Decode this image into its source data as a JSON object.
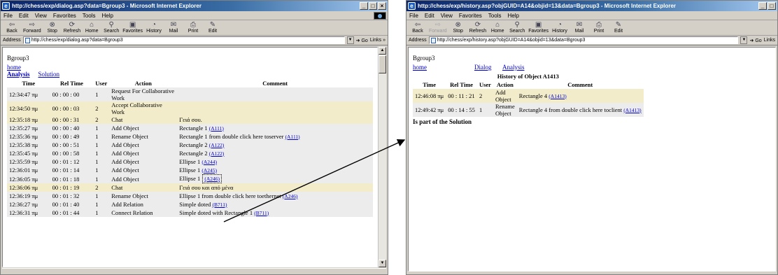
{
  "left_window": {
    "title": "http://chess/exp/dialog.asp?data=Bgroup3 - Microsoft Internet Explorer",
    "menu": [
      "File",
      "Edit",
      "View",
      "Favorites",
      "Tools",
      "Help"
    ],
    "toolbar": [
      "Back",
      "Forward",
      "Stop",
      "Refresh",
      "Home",
      "Search",
      "Favorites",
      "History",
      "Mail",
      "Print",
      "Edit"
    ],
    "address_label": "Address",
    "address": "http://chess/exp/dialog.asp?data=Bgroup3",
    "go": "Go",
    "links": "Links »",
    "page": {
      "heading": "Bgroup3",
      "home_link": "home",
      "analysis_link": "Analysis",
      "solution_link": "Solution",
      "columns": [
        "Time",
        "Rel Time",
        "User",
        "Action",
        "Comment"
      ],
      "rows": [
        {
          "time": "12:34:47 πμ",
          "rel": "00 : 00 : 00",
          "user": "1",
          "action": "Request For Collaborative Work",
          "comment": "",
          "ref": "",
          "style": "gr"
        },
        {
          "time": "12:34:50 πμ",
          "rel": "00 : 00 : 03",
          "user": "2",
          "action": "Accept Collaborative Work",
          "comment": "",
          "ref": "",
          "style": "hl"
        },
        {
          "time": "12:35:18 πμ",
          "rel": "00 : 00 : 31",
          "user": "2",
          "action": "Chat",
          "comment": "Γειά σου.",
          "ref": "",
          "style": "hl"
        },
        {
          "time": "12:35:27 πμ",
          "rel": "00 : 00 : 40",
          "user": "1",
          "action": "Add Object",
          "comment": "Rectangle 1",
          "ref": "(A111)",
          "style": "gr"
        },
        {
          "time": "12:35:36 πμ",
          "rel": "00 : 00 : 49",
          "user": "1",
          "action": "Rename Object",
          "comment": "Rectangle 1 from double click here toserver",
          "ref": "(A111)",
          "style": "gr"
        },
        {
          "time": "12:35:38 πμ",
          "rel": "00 : 00 : 51",
          "user": "1",
          "action": "Add Object",
          "comment": "Rectangle 2",
          "ref": "(A122)",
          "style": "gr"
        },
        {
          "time": "12:35:45 πμ",
          "rel": "00 : 00 : 58",
          "user": "1",
          "action": "Add Object",
          "comment": "Rectangle 2",
          "ref": "(A122)",
          "style": "gr"
        },
        {
          "time": "12:35:59 πμ",
          "rel": "00 : 01 : 12",
          "user": "1",
          "action": "Add Object",
          "comment": "Ellipse 1",
          "ref": "(A244)",
          "style": "gr"
        },
        {
          "time": "12:36:01 πμ",
          "rel": "00 : 01 : 14",
          "user": "1",
          "action": "Add Object",
          "comment": "Ellipse 1",
          "ref": "(A245)",
          "style": "gr"
        },
        {
          "time": "12:36:05 πμ",
          "rel": "00 : 01 : 18",
          "user": "1",
          "action": "Add Object",
          "comment": "Ellipse 1",
          "ref": "(A246)",
          "style": "gr",
          "boxed": true
        },
        {
          "time": "12:36:06 πμ",
          "rel": "00 : 01 : 19",
          "user": "2",
          "action": "Chat",
          "comment": "Γειά σου και από μένα",
          "ref": "",
          "style": "hl"
        },
        {
          "time": "12:36:19 πμ",
          "rel": "00 : 01 : 32",
          "user": "1",
          "action": "Rename Object",
          "comment": "Ellipse 1 from double click here toethernet",
          "ref": "(A246)",
          "style": "gr"
        },
        {
          "time": "12:36:27 πμ",
          "rel": "00 : 01 : 40",
          "user": "1",
          "action": "Add Relation",
          "comment": "Simple doted",
          "ref": "(B711)",
          "style": "gr"
        },
        {
          "time": "12:36:31 πμ",
          "rel": "00 : 01 : 44",
          "user": "1",
          "action": "Connect Relation",
          "comment": "Simple doted with Rectangle 1",
          "ref": "(B711)",
          "style": "gr"
        }
      ]
    }
  },
  "right_window": {
    "title": "http://chess/exp/history.asp?objGUID=A14&objid=13&data=Bgroup3 - Microsoft Internet Explorer",
    "menu": [
      "File",
      "Edit",
      "View",
      "Favorites",
      "Tools",
      "Help"
    ],
    "toolbar": [
      "Back",
      "Forward",
      "Stop",
      "Refresh",
      "Home",
      "Search",
      "Favorites",
      "History",
      "Mail",
      "Print",
      "Edit"
    ],
    "address_label": "Address",
    "address": "http://chess/exp/history.asp?objGUID=A14&objid=13&data=Bgroup3",
    "go": "Go",
    "links": "Links",
    "page": {
      "heading": "Bgroup3",
      "home_link": "home",
      "dialog_link": "Dialog",
      "analysis_link": "Analysis",
      "section_title": "History of Object A1413",
      "columns": [
        "Time",
        "Rel Time",
        "User",
        "Action",
        "Comment"
      ],
      "rows": [
        {
          "time": "12:46:08 πμ",
          "rel": "00 : 11 : 21",
          "user": "2",
          "action": "Add Object",
          "comment": "Rectangle 4",
          "ref": "(A1413)",
          "style": "hl"
        },
        {
          "time": "12:49:42 πμ",
          "rel": "00 : 14 : 55",
          "user": "1",
          "action": "Rename Object",
          "comment": "Rectangle 4 from double click here toclient",
          "ref": "(A1413)",
          "style": "gr"
        }
      ],
      "footer": "Is part of the Solution"
    }
  },
  "colors": {
    "title_bar": "#0a246a",
    "row_highlight": "#f2eccb",
    "row_gray": "#ececec",
    "link": "#0000cc",
    "visited": "#800080"
  }
}
